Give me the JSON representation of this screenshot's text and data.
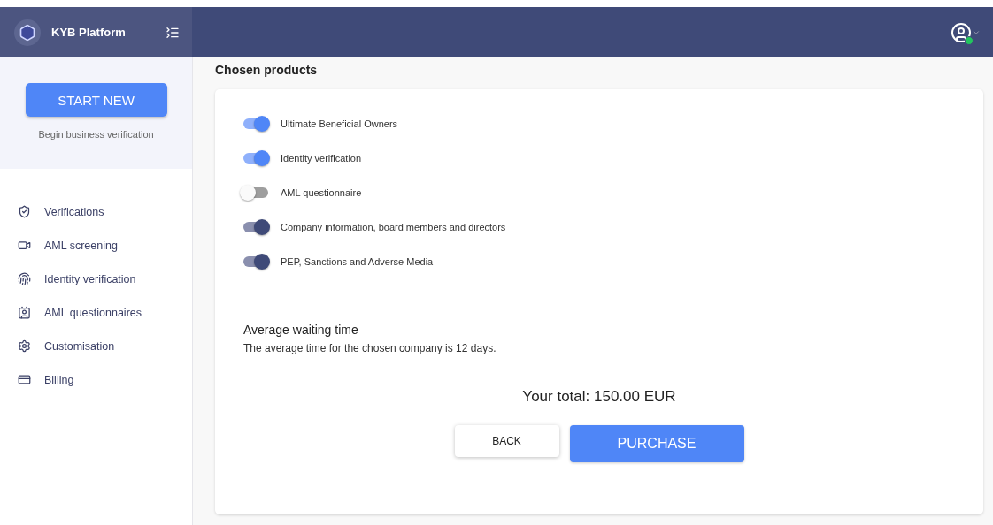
{
  "brand": {
    "name": "KYB Platform"
  },
  "sidebar": {
    "start_button": "START NEW",
    "start_caption": "Begin business verification",
    "items": [
      {
        "label": "Verifications",
        "kind": "shield"
      },
      {
        "label": "AML screening",
        "kind": "video"
      },
      {
        "label": "Identity verification",
        "kind": "fingerprint"
      },
      {
        "label": "AML questionnaires",
        "kind": "badge"
      },
      {
        "label": "Customisation",
        "kind": "settings"
      },
      {
        "label": "Billing",
        "kind": "card"
      }
    ]
  },
  "user": {
    "online": true
  },
  "page_title": "Chosen products",
  "products": [
    {
      "label": "Ultimate Beneficial Owners",
      "on": true,
      "disabled": false
    },
    {
      "label": "Identity verification",
      "on": true,
      "disabled": false
    },
    {
      "label": "AML questionnaire",
      "on": false,
      "disabled": false
    },
    {
      "label": "Company information, board members and directors",
      "on": true,
      "disabled": true
    },
    {
      "label": "PEP, Sanctions and Adverse Media",
      "on": true,
      "disabled": true
    }
  ],
  "waiting": {
    "title": "Average waiting time",
    "text": "The average time for the chosen company is 12 days."
  },
  "total": "Your total: 150.00 EUR",
  "buttons": {
    "back": "BACK",
    "purchase": "PURCHASE"
  }
}
